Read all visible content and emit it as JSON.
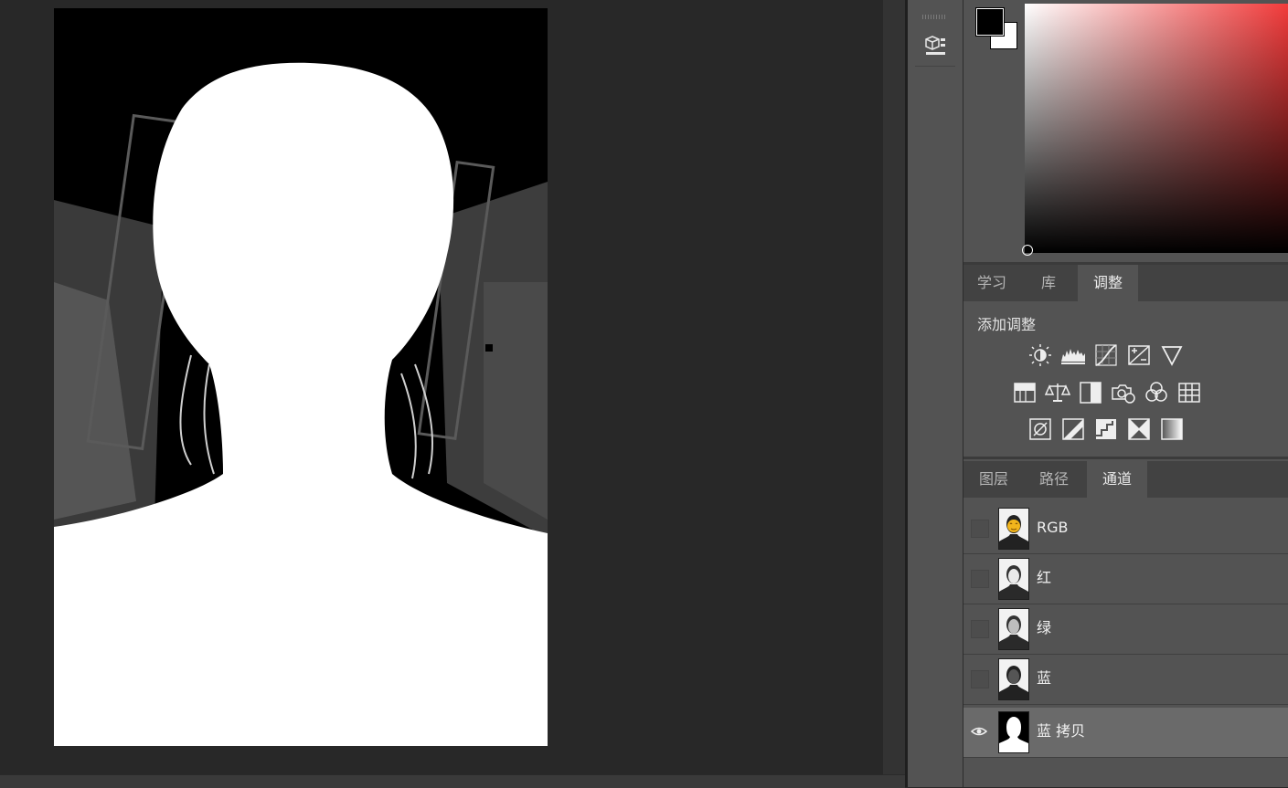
{
  "colors": {
    "foreground": "#000000",
    "background": "#ffffff",
    "hue_accent": "#f23b3b"
  },
  "adjust_panel": {
    "tabs": [
      {
        "label": "学习",
        "active": false
      },
      {
        "label": "库",
        "active": false
      },
      {
        "label": "调整",
        "active": true
      }
    ],
    "title": "添加调整",
    "rows": [
      [
        "brightness-contrast-icon",
        "levels-icon",
        "curves-icon",
        "exposure-icon",
        "vibrance-icon"
      ],
      [
        "hue-saturation-icon",
        "color-balance-icon",
        "black-white-icon",
        "photo-filter-icon",
        "channel-mixer-icon",
        "color-lookup-icon"
      ],
      [
        "invert-icon",
        "posterize-icon",
        "threshold-icon",
        "selective-color-icon",
        "gradient-map-icon"
      ]
    ]
  },
  "channels_panel": {
    "tabs": [
      {
        "label": "图层",
        "active": false
      },
      {
        "label": "路径",
        "active": false
      },
      {
        "label": "通道",
        "active": true
      }
    ],
    "channels": [
      {
        "name": "RGB",
        "visible": false,
        "selected": false,
        "thumb": "rgb"
      },
      {
        "name": "红",
        "visible": false,
        "selected": false,
        "thumb": "red"
      },
      {
        "name": "绿",
        "visible": false,
        "selected": false,
        "thumb": "green"
      },
      {
        "name": "蓝",
        "visible": false,
        "selected": false,
        "thumb": "blue"
      },
      {
        "name": "蓝 拷贝",
        "visible": true,
        "selected": true,
        "thumb": "mask"
      }
    ]
  },
  "toolbar_strip": {
    "icons": [
      "panel-grip-icon",
      "libraries-3d-icon"
    ]
  }
}
